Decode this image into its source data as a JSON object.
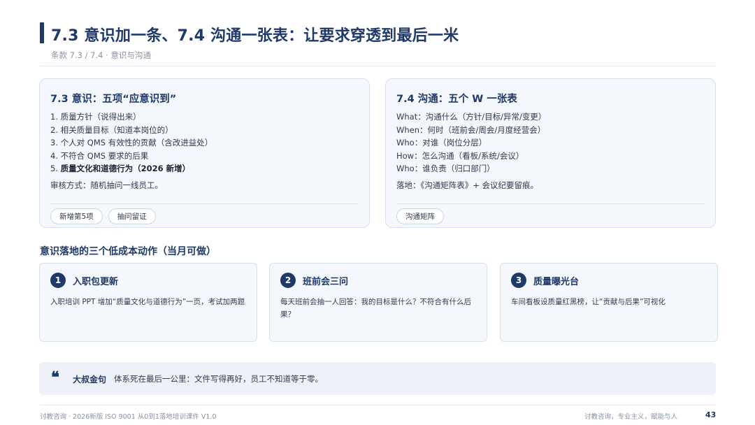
{
  "header": {
    "title": "7.3 意识加一条、7.4 沟通一张表：让要求穿透到最后一米",
    "subtitle": "条款 7.3 / 7.4 · 意识与沟通"
  },
  "left_card": {
    "title": "7.3 意识：五项“应意识到”",
    "items": [
      "1. 质量方针（说得出来）",
      "2. 相关质量目标（知道本岗位的）",
      "3. 个人对 QMS 有效性的贡献（含改进益处）",
      "4. 不符合 QMS 要求的后果"
    ],
    "item5_prefix": "5. ",
    "item5_bold": "质量文化和道德行为（2026 新增）",
    "note": "审核方式：随机抽问一线员工。",
    "tags": [
      "新增第5项",
      "抽问留证"
    ]
  },
  "right_card": {
    "title": "7.4 沟通：五个 W 一张表",
    "items": [
      "What：沟通什么（方针/目标/异常/变更）",
      "When：何时（班前会/周会/月度经营会）",
      "Who：对谁（岗位分层）",
      "How：怎么沟通（看板/系统/会议）",
      "Who：谁负责（归口部门）"
    ],
    "note": "落地：《沟通矩阵表》+ 会议纪要留痕。",
    "tags": [
      "沟通矩阵"
    ]
  },
  "actions_section": {
    "title": "意识落地的三个低成本动作（当月可做）",
    "actions": [
      {
        "num": "1",
        "title": "入职包更新",
        "desc": "入职培训 PPT 增加“质量文化与道德行为”一页，考试加两题"
      },
      {
        "num": "2",
        "title": "班前会三问",
        "desc": "每天班前会抽一人回答：我的目标是什么？不符合有什么后果？"
      },
      {
        "num": "3",
        "title": "质量曝光台",
        "desc": "车间看板设质量红黑榜，让“贡献与后果”可视化"
      }
    ]
  },
  "quote": {
    "mark": "❝",
    "label": "大叔金句",
    "text": "体系死在最后一公里：文件写得再好，员工不知道等于零。"
  },
  "footer": {
    "left": "讨教咨询 · 2026新版 ISO 9001 从0到1落地培训课件 V1.0",
    "right": "讨教咨询，专业主义，赋能与人",
    "page": "43"
  },
  "colors": {
    "accent": "#1f3a68",
    "card_bg": "#f4f7fb",
    "card_border": "#d7e1ee",
    "muted": "#8a93a3"
  }
}
